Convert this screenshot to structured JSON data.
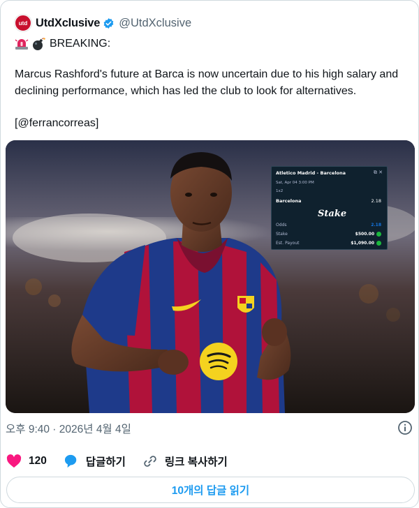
{
  "tweet": {
    "avatar_text": "utd",
    "display_name": "UtdXclusive",
    "handle": "@UtdXclusive",
    "emojis": [
      "siren-icon",
      "bomb-icon"
    ],
    "breaking": "BREAKING:",
    "body": "Marcus Rashford's future at Barca is now uncertain due to his high salary and declining performance, which has led the club to look for alternatives.",
    "mention": "[@ferrancorreas]"
  },
  "bet_slip": {
    "match": "Atletico Madrid - Barcelona",
    "date": "Sat, Apr 04  3:00 PM",
    "market": "1x2",
    "selection": "Barcelona",
    "selection_odds": "2.18",
    "brand": "Stake",
    "odds_label": "Odds",
    "odds_value": "2.18",
    "stake_label": "Stake",
    "stake_value": "$500.00",
    "payout_label": "Est. Payout",
    "payout_value": "$1,090.00"
  },
  "footer": {
    "timestamp": "오후 9:40 · 2026년 4월 4일",
    "likes": "120",
    "reply_label": "답글하기",
    "copy_link_label": "링크 복사하기",
    "read_replies_label": "10개의 답글 읽기"
  },
  "colors": {
    "accent": "#1d9bf0",
    "like": "#f91880",
    "muted": "#536471",
    "barca_blue": "#1e3a8a",
    "barca_red": "#b0123a",
    "spotify_yellow": "#f4d21f"
  }
}
